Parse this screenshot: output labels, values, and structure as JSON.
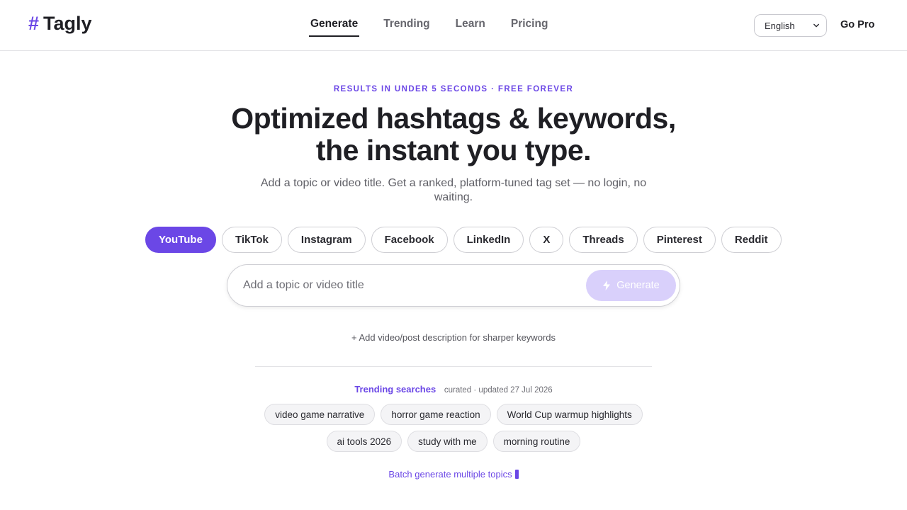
{
  "brand": {
    "hash": "#",
    "name": "Tagly"
  },
  "nav": {
    "items": [
      {
        "label": "Generate",
        "active": true
      },
      {
        "label": "Trending",
        "active": false
      },
      {
        "label": "Learn",
        "active": false
      },
      {
        "label": "Pricing",
        "active": false
      }
    ]
  },
  "header": {
    "language": "English",
    "go_pro": "Go Pro"
  },
  "hero": {
    "eyebrow": "RESULTS IN UNDER 5 SECONDS · FREE FOREVER",
    "headline_line1": "Optimized hashtags & keywords,",
    "headline_line2": "the instant you type.",
    "subtext": "Add a topic or video title. Get a ranked, platform-tuned tag set — no login, no waiting."
  },
  "platforms": [
    {
      "label": "YouTube",
      "active": true
    },
    {
      "label": "TikTok",
      "active": false
    },
    {
      "label": "Instagram",
      "active": false
    },
    {
      "label": "Facebook",
      "active": false
    },
    {
      "label": "LinkedIn",
      "active": false
    },
    {
      "label": "X",
      "active": false
    },
    {
      "label": "Threads",
      "active": false
    },
    {
      "label": "Pinterest",
      "active": false
    },
    {
      "label": "Reddit",
      "active": false
    }
  ],
  "search": {
    "placeholder": "Add a topic or video title",
    "value": "",
    "button_label": "Generate"
  },
  "add_description": "+ Add video/post description for sharper keywords",
  "trending": {
    "title": "Trending searches",
    "meta": "curated · updated 27 Jul 2026",
    "tags": [
      "video game narrative",
      "horror game reaction",
      "World Cup warmup highlights",
      "ai tools 2026",
      "study with me",
      "morning routine"
    ]
  },
  "batch_link": "Batch generate multiple topics",
  "colors": {
    "accent": "#6b47e6",
    "accent_disabled": "#d9d0fb",
    "text": "#1f1f24",
    "muted": "#5f5f66",
    "border": "#cfcfd4"
  },
  "icons": {
    "generate_button": "lightning-bolt-icon",
    "language_select": "chevron-down-icon",
    "batch_link": "batch-icon"
  }
}
